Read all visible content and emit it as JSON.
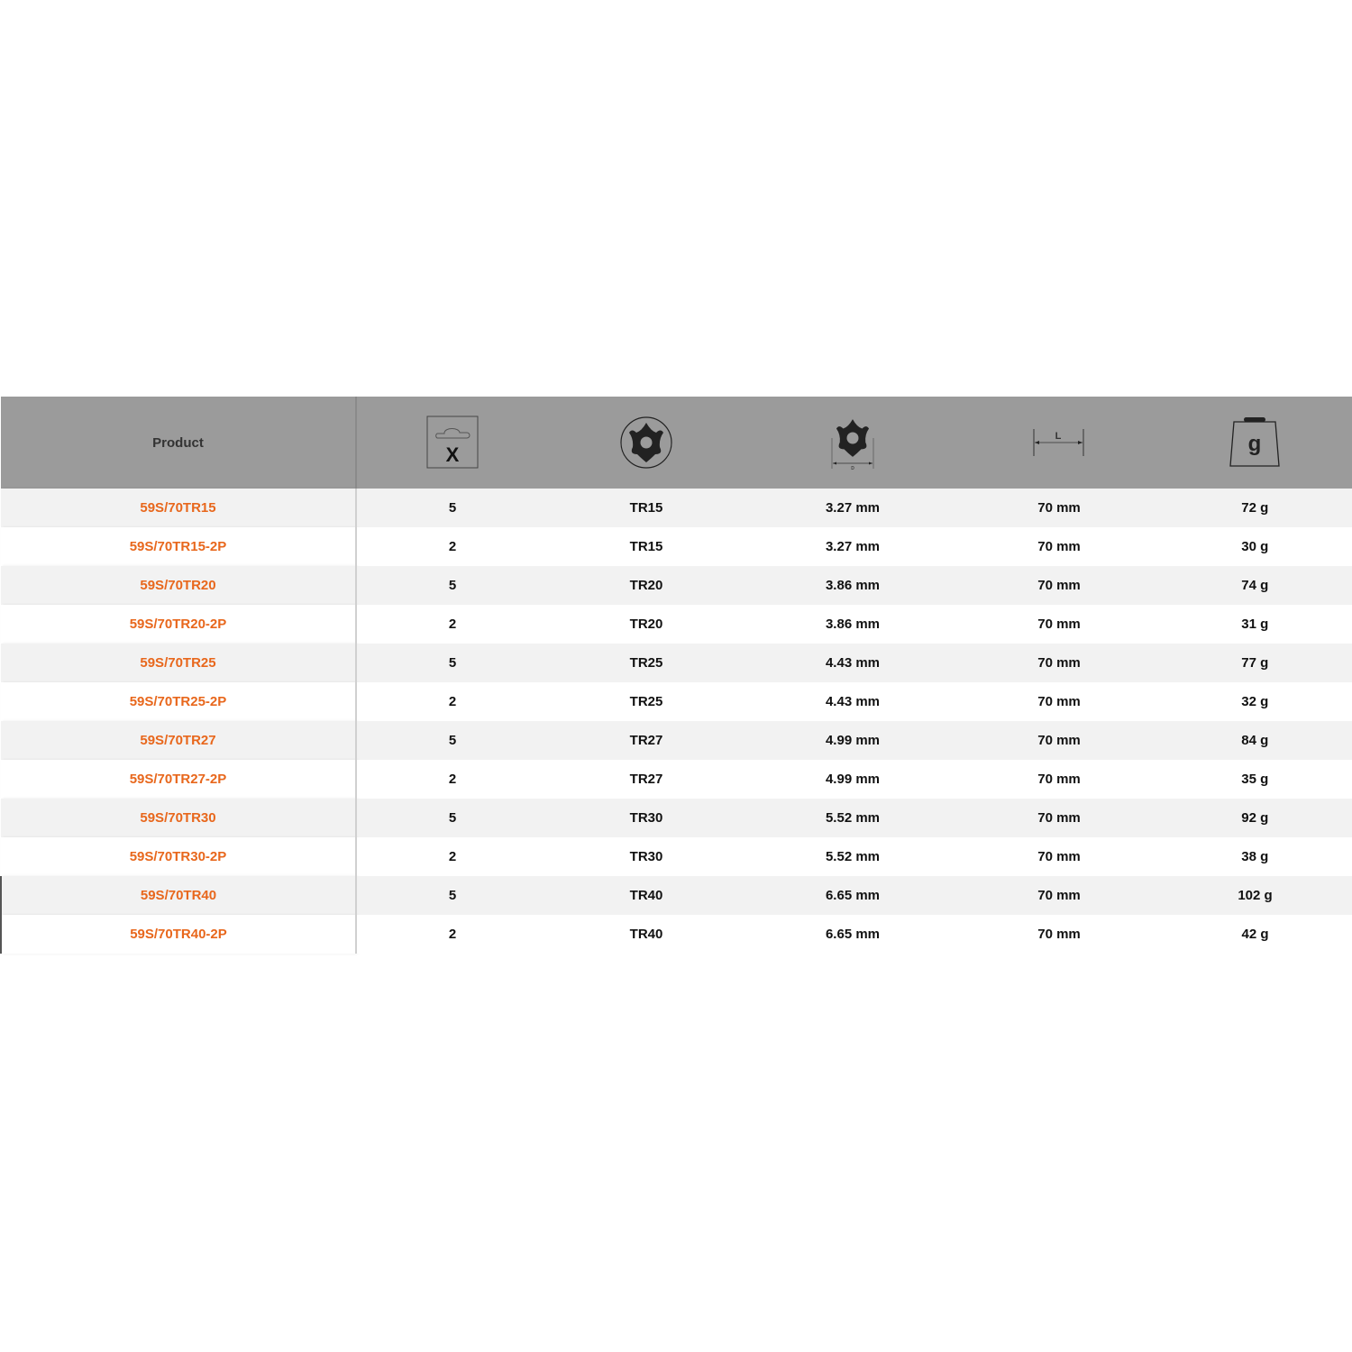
{
  "table": {
    "headers": [
      {
        "label": "Product",
        "icon": null
      },
      {
        "label": "",
        "icon": "package-quantity-icon"
      },
      {
        "label": "",
        "icon": "torx-drive-icon"
      },
      {
        "label": "",
        "icon": "torx-diameter-icon"
      },
      {
        "label": "",
        "icon": "length-icon"
      },
      {
        "label": "",
        "icon": "weight-icon"
      }
    ],
    "icon_glyphs": {
      "quantity": "X",
      "length": "L",
      "weight": "g",
      "diameter": "D"
    },
    "accent_color": "#e8671c",
    "rows": [
      {
        "product": "59S/70TR15",
        "qty": "5",
        "size": "TR15",
        "diameter": "3.27 mm",
        "length": "70 mm",
        "weight": "72 g"
      },
      {
        "product": "59S/70TR15-2P",
        "qty": "2",
        "size": "TR15",
        "diameter": "3.27 mm",
        "length": "70 mm",
        "weight": "30 g"
      },
      {
        "product": "59S/70TR20",
        "qty": "5",
        "size": "TR20",
        "diameter": "3.86 mm",
        "length": "70 mm",
        "weight": "74 g"
      },
      {
        "product": "59S/70TR20-2P",
        "qty": "2",
        "size": "TR20",
        "diameter": "3.86 mm",
        "length": "70 mm",
        "weight": "31 g"
      },
      {
        "product": "59S/70TR25",
        "qty": "5",
        "size": "TR25",
        "diameter": "4.43 mm",
        "length": "70 mm",
        "weight": "77 g"
      },
      {
        "product": "59S/70TR25-2P",
        "qty": "2",
        "size": "TR25",
        "diameter": "4.43 mm",
        "length": "70 mm",
        "weight": "32 g"
      },
      {
        "product": "59S/70TR27",
        "qty": "5",
        "size": "TR27",
        "diameter": "4.99 mm",
        "length": "70 mm",
        "weight": "84 g"
      },
      {
        "product": "59S/70TR27-2P",
        "qty": "2",
        "size": "TR27",
        "diameter": "4.99 mm",
        "length": "70 mm",
        "weight": "35 g"
      },
      {
        "product": "59S/70TR30",
        "qty": "5",
        "size": "TR30",
        "diameter": "5.52 mm",
        "length": "70 mm",
        "weight": "92 g"
      },
      {
        "product": "59S/70TR30-2P",
        "qty": "2",
        "size": "TR30",
        "diameter": "5.52 mm",
        "length": "70 mm",
        "weight": "38 g"
      },
      {
        "product": "59S/70TR40",
        "qty": "5",
        "size": "TR40",
        "diameter": "6.65 mm",
        "length": "70 mm",
        "weight": "102 g"
      },
      {
        "product": "59S/70TR40-2P",
        "qty": "2",
        "size": "TR40",
        "diameter": "6.65 mm",
        "length": "70 mm",
        "weight": "42 g"
      }
    ]
  }
}
